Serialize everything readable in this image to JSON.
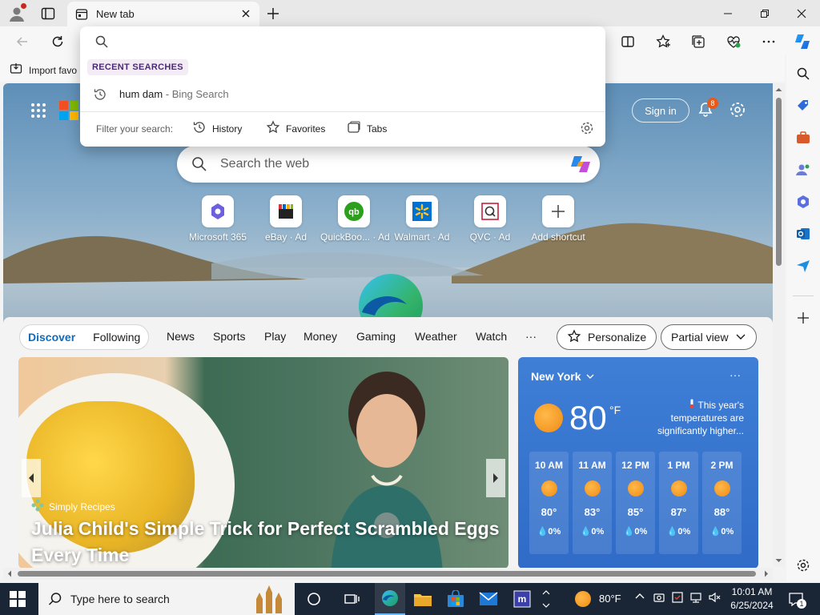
{
  "tab": {
    "title": "New tab"
  },
  "favorites_bar": {
    "import_label": "Import favo"
  },
  "page": {
    "signin_label": "Sign in",
    "notification_count": "8",
    "search_placeholder": "Search the web",
    "shortcuts": [
      {
        "label": "Microsoft 365",
        "icon": "microsoft-365-icon"
      },
      {
        "label": "eBay · Ad",
        "icon": "ebay-icon"
      },
      {
        "label": "QuickBoo... · Ad",
        "icon": "quickbooks-icon"
      },
      {
        "label": "Walmart · Ad",
        "icon": "walmart-icon"
      },
      {
        "label": "QVC · Ad",
        "icon": "qvc-icon"
      },
      {
        "label": "Add shortcut",
        "icon": "plus-icon"
      }
    ]
  },
  "feed": {
    "toggle": {
      "discover": "Discover",
      "following": "Following"
    },
    "nav": [
      "News",
      "Sports",
      "Play",
      "Money",
      "Gaming",
      "Weather",
      "Watch",
      "···"
    ],
    "personalize_label": "Personalize",
    "view_label": "Partial view",
    "hero": {
      "source": "Simply Recipes",
      "headline": "Julia Child's Simple Trick for Perfect Scrambled Eggs Every Time"
    },
    "weather": {
      "city": "New York",
      "more": "···",
      "temp": "80",
      "unit": "°F",
      "note": "This year's temperatures are significantly higher...",
      "hours": [
        {
          "time": "10 AM",
          "temp": "80°",
          "precip": "0%"
        },
        {
          "time": "11 AM",
          "temp": "83°",
          "precip": "0%"
        },
        {
          "time": "12 PM",
          "temp": "85°",
          "precip": "0%"
        },
        {
          "time": "1 PM",
          "temp": "87°",
          "precip": "0%"
        },
        {
          "time": "2 PM",
          "temp": "88°",
          "precip": "0%"
        }
      ]
    }
  },
  "dropdown": {
    "recent_label": "RECENT SEARCHES",
    "recent_query": "hum dam",
    "recent_source": " - Bing Search",
    "filter_label": "Filter your search:",
    "filters": [
      "History",
      "Favorites",
      "Tabs"
    ]
  },
  "taskbar": {
    "search_placeholder": "Type here to search",
    "weather_temp": "80°F",
    "time": "10:01 AM",
    "date": "6/25/2024",
    "notification_count": "1"
  },
  "colors": {
    "accent": "#0f6cbd",
    "taskbar": "#1a2536",
    "weather_card": "#2f6bc7"
  }
}
